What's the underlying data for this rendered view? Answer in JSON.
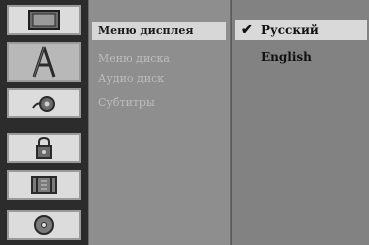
{
  "icons": [
    {
      "name": "tv-icon"
    },
    {
      "name": "language-a-icon"
    },
    {
      "name": "audio-icon"
    },
    {
      "name": "lock-icon"
    },
    {
      "name": "film-icon"
    },
    {
      "name": "disc-icon"
    }
  ],
  "menu": {
    "items": [
      {
        "label": "Меню дисплея",
        "selected": true
      },
      {
        "label": "Меню диска",
        "selected": false
      },
      {
        "label": "Аудио диск",
        "selected": false
      },
      {
        "label": "Субтитры",
        "selected": false
      }
    ]
  },
  "options": {
    "items": [
      {
        "label": "Русский",
        "checked": true
      },
      {
        "label": "English",
        "checked": false
      }
    ],
    "check_glyph": "✔"
  },
  "colors": {
    "selected_bg": "#d7d7d7",
    "menu_bg": "#8e8e8e",
    "option_bg": "#828282",
    "icon_col_bg": "#2c2c2c"
  }
}
